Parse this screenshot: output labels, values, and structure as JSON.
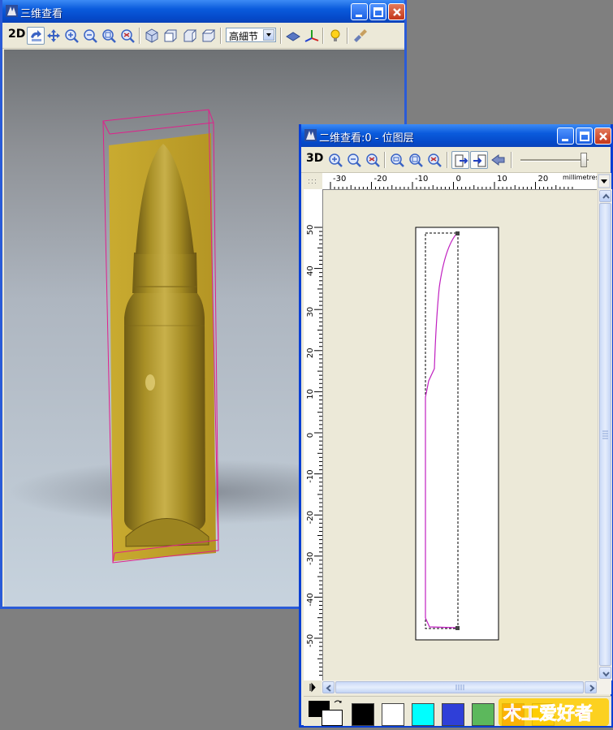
{
  "window3d": {
    "title": "三维查看",
    "mode_label": "2D",
    "detail_select": "高細节"
  },
  "window2d": {
    "title": "二维查看:0 - 位图层",
    "mode_label": "3D",
    "units": "millimetres",
    "ruler_x_ticks": [
      "-30",
      "-20",
      "-10",
      "0",
      "10",
      "20"
    ],
    "ruler_y_ticks": [
      "50",
      "40",
      "30",
      "20",
      "10",
      "0",
      "-10",
      "-20",
      "-30",
      "-40",
      "-50"
    ],
    "palette": [
      "#000000",
      "#ffffff",
      "#00ffff",
      "#2f3fd8",
      "#5cb85c",
      "#e52020",
      "#f5d020"
    ],
    "foreground_color": "#000000",
    "background_color": "#ffffff"
  },
  "watermark": {
    "text": "木工爱好者"
  },
  "colors": {
    "accent": "#0a5bdc",
    "model_gold": "#b39a2a",
    "bounding_box": "#e0208c"
  }
}
